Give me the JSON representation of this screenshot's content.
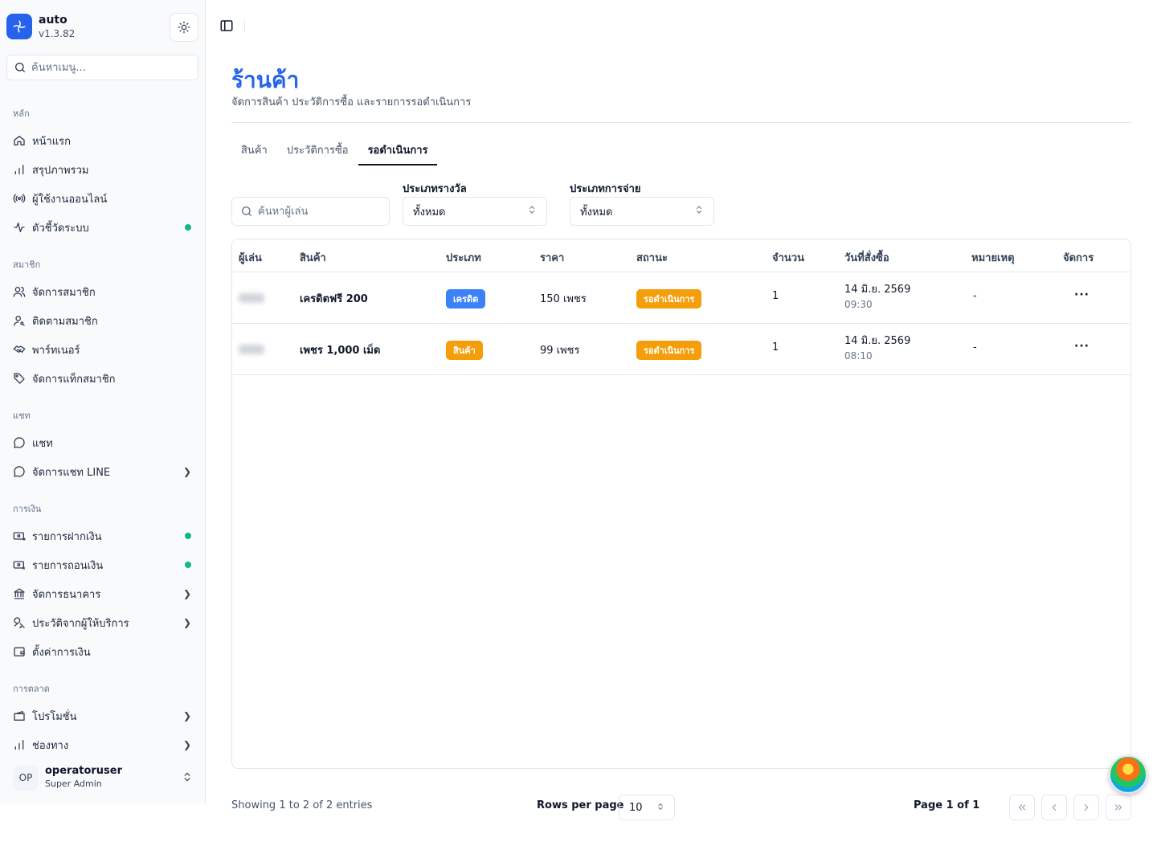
{
  "app": {
    "name": "auto",
    "version": "v1.3.82"
  },
  "sidebar": {
    "search_placeholder": "ค้นหาเมนู...",
    "groups": [
      {
        "label": "หลัก"
      },
      {
        "label": "สมาชิก"
      },
      {
        "label": "แชท"
      },
      {
        "label": "การเงิน"
      },
      {
        "label": "การตลาด"
      }
    ],
    "items": [
      {
        "label": "หน้าแรก",
        "icon": "home-icon"
      },
      {
        "label": "สรุปภาพรวม",
        "icon": "bar-chart-icon"
      },
      {
        "label": "ผู้ใช้งานออนไลน์",
        "icon": "radio-icon"
      },
      {
        "label": "ตัวชี้วัดระบบ",
        "icon": "activity-icon",
        "status": "online"
      },
      {
        "label": "จัดการสมาชิก",
        "icon": "users-icon"
      },
      {
        "label": "ติดตามสมาชิก",
        "icon": "user-search-icon"
      },
      {
        "label": "พาร์ทเนอร์",
        "icon": "handshake-icon"
      },
      {
        "label": "จัดการแท็กสมาชิก",
        "icon": "tag-icon"
      },
      {
        "label": "แชท",
        "icon": "chat-icon"
      },
      {
        "label": "จัดการแชท LINE",
        "icon": "chat-icon",
        "expandable": true
      },
      {
        "label": "รายการฝากเงิน",
        "icon": "deposit-icon",
        "status": "online"
      },
      {
        "label": "รายการถอนเงิน",
        "icon": "withdraw-icon",
        "status": "online"
      },
      {
        "label": "จัดการธนาคาร",
        "icon": "bank-icon",
        "expandable": true
      },
      {
        "label": "ประวัติจากผู้ให้บริการ",
        "icon": "provider-icon",
        "expandable": true
      },
      {
        "label": "ตั้งค่าการเงิน",
        "icon": "wallet-icon"
      },
      {
        "label": "โปรโมชั่น",
        "icon": "promo-icon",
        "expandable": true
      },
      {
        "label": "ช่องทาง",
        "icon": "bar-chart-icon",
        "expandable": true
      }
    ],
    "user": {
      "initials": "OP",
      "name": "operatoruser",
      "role": "Super Admin"
    }
  },
  "page": {
    "title": "ร้านค้า",
    "subtitle": "จัดการสินค้า ประวัติการซื้อ และรายการรอดำเนินการ",
    "tabs": [
      {
        "label": "สินค้า"
      },
      {
        "label": "ประวัติการซื้อ"
      },
      {
        "label": "รอดำเนินการ",
        "active": true
      }
    ],
    "filters": {
      "search_placeholder": "ค้นหาผู้เล่น",
      "reward_type_label": "ประเภทรางวัล",
      "reward_type_value": "ทั้งหมด",
      "payment_type_label": "ประเภทการจ่าย",
      "payment_type_value": "ทั้งหมด"
    },
    "table": {
      "columns": [
        "ผู้เล่น",
        "สินค้า",
        "ประเภท",
        "ราคา",
        "สถานะ",
        "จำนวน",
        "วันที่สั่งซื้อ",
        "หมายเหตุ",
        "จัดการ"
      ],
      "rows": [
        {
          "product": "เครดิตฟรี 200",
          "type": "เครดิต",
          "type_color": "#3b82f6",
          "price": "150 เพชร",
          "status": "รอดำเนินการ",
          "status_color": "#f59e0b",
          "qty": "1",
          "date": "14 มิ.ย. 2569",
          "time": "09:30",
          "note": "-",
          "action": "···"
        },
        {
          "product": "เพชร 1,000 เม็ด",
          "type": "สินค้า",
          "type_color": "#f59e0b",
          "price": "99 เพชร",
          "status": "รอดำเนินการ",
          "status_color": "#f59e0b",
          "qty": "1",
          "date": "14 มิ.ย. 2569",
          "time": "08:10",
          "note": "-",
          "action": "···"
        }
      ]
    },
    "footer": {
      "showing": "Showing 1 to 2 of 2 entries",
      "rows_per_page_label": "Rows per page",
      "rows_per_page_value": "10",
      "page_info": "Page 1 of 1"
    }
  },
  "colors": {
    "accent": "#2563eb",
    "online": "#10b981"
  }
}
